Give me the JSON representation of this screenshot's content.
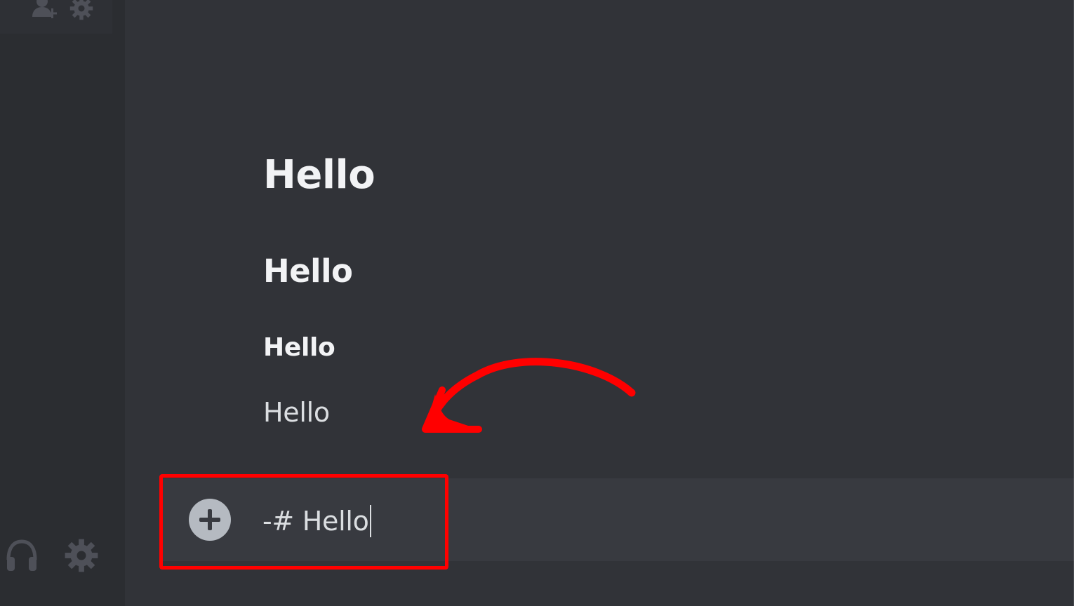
{
  "messages": [
    {
      "style": "heading-1",
      "text": "Hello"
    },
    {
      "style": "heading-2",
      "text": "Hello"
    },
    {
      "style": "heading-3",
      "text": "Hello"
    },
    {
      "style": "paragraph",
      "text": "Hello"
    }
  ],
  "composer": {
    "value": "-# Hello",
    "attach_icon": "plus-circle-icon"
  },
  "sidebar": {
    "top_icons": [
      "add-friend-icon",
      "gear-icon"
    ],
    "bottom_icons": [
      "headphones-icon",
      "gear-icon"
    ]
  },
  "annotation": {
    "color": "#ff0000"
  },
  "theme": {
    "background": "#313338",
    "sidebar": "#2b2d31",
    "input": "#383a40",
    "text": "#f2f3f5"
  }
}
